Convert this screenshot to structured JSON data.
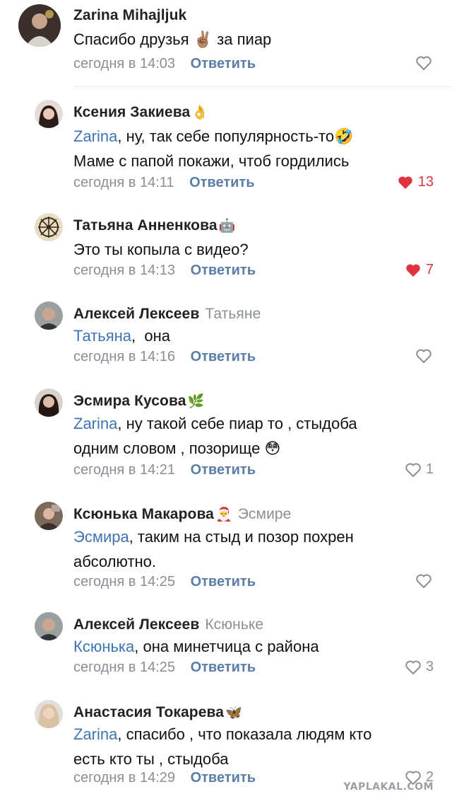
{
  "reply_label": "Ответить",
  "comments": [
    {
      "author": "Zarina Mihajljuk",
      "author_emoji": "",
      "reply_to": "",
      "mention": "",
      "text_lines": [
        "Спасибо друзья ✌🏽 за пиар"
      ],
      "time": "сегодня в 14:03",
      "liked": false,
      "likes": ""
    },
    {
      "author": "Ксения Закиева",
      "author_emoji": "👌",
      "reply_to": "",
      "mention": "Zarina",
      "text_lines": [
        ", ну, так себе популярность-то🤣",
        "Маме с папой покажи, чтоб гордились"
      ],
      "time": "сегодня в 14:11",
      "liked": true,
      "likes": "13"
    },
    {
      "author": "Татьяна Анненкова",
      "author_emoji": "🤖",
      "reply_to": "",
      "mention": "",
      "text_lines": [
        "Это ты копыла с видео?"
      ],
      "time": "сегодня в 14:13",
      "liked": true,
      "likes": "7"
    },
    {
      "author": "Алексей Лексеев",
      "author_emoji": "",
      "reply_to": "Татьяне",
      "mention": "Татьяна",
      "text_lines": [
        ",  она"
      ],
      "time": "сегодня в 14:16",
      "liked": false,
      "likes": ""
    },
    {
      "author": "Эсмира Кусова",
      "author_emoji": "🌿",
      "reply_to": "",
      "mention": "Zarina",
      "text_lines": [
        ", ну такой себе пиар то , стыдоба",
        "одним словом , позорище 😳"
      ],
      "time": "сегодня в 14:21",
      "liked": false,
      "likes": "1"
    },
    {
      "author": "Ксюнька Макарова",
      "author_emoji": "🎅",
      "reply_to": "Эсмире",
      "mention": "Эсмира",
      "text_lines": [
        ", таким на стыд и позор похрен",
        "абсолютно."
      ],
      "time": "сегодня в 14:25",
      "liked": false,
      "likes": ""
    },
    {
      "author": "Алексей Лексеев",
      "author_emoji": "",
      "reply_to": "Ксюньке",
      "mention": "Ксюнька",
      "text_lines": [
        ", она минетчица с района"
      ],
      "time": "сегодня в 14:25",
      "liked": false,
      "likes": "3"
    },
    {
      "author": "Анастасия Токарева",
      "author_emoji": "🦋",
      "reply_to": "",
      "mention": "Zarina",
      "text_lines": [
        ", спасибо , что показала людям кто",
        "есть кто ты , стыдоба"
      ],
      "time": "сегодня в 14:29",
      "liked": false,
      "likes": "2"
    }
  ],
  "watermark": "YAPLAKAL.COM",
  "colors": {
    "mention": "#3f74b4",
    "reply_link": "#5a7ea8",
    "meta_gray": "#8a8f96",
    "like_red": "#e0333f"
  }
}
